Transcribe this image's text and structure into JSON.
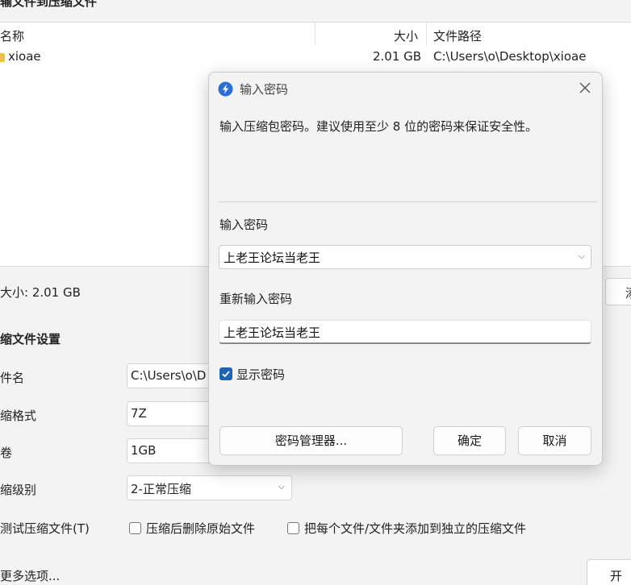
{
  "window": {
    "title_fragment": "输文件到压缩文件"
  },
  "file_list": {
    "columns": {
      "name": "名称",
      "size": "大小",
      "path": "文件路径"
    },
    "rows": [
      {
        "name": "xioae",
        "size": "2.01 GB",
        "path": "C:\\Users\\o\\Desktop\\xioae"
      }
    ]
  },
  "summary": {
    "size_text": "大小: 2.01 GB",
    "right_button_fragment": "添"
  },
  "settings": {
    "title": "缩文件设置",
    "fields": [
      {
        "label": "件名",
        "value": "C:\\Users\\o\\D"
      },
      {
        "label": "缩格式",
        "value": "7Z"
      },
      {
        "label": "卷",
        "value": "1GB"
      },
      {
        "label": "缩级别",
        "value": "2-正常压缩"
      }
    ],
    "test_label": "测试压缩文件(T)",
    "delete_after": "压缩后删除原始文件",
    "each_separate": "把每个文件/文件夹添加到独立的压缩文件",
    "more_options": "更多选项...",
    "start_button_fragment": "开"
  },
  "dialog": {
    "title": "输入密码",
    "description": "输入压缩包密码。建议使用至少 8 位的密码来保证安全性。",
    "password_label": "输入密码",
    "password_value": "上老王论坛当老王",
    "reenter_label": "重新输入密码",
    "reenter_value": "上老王论坛当老王",
    "show_password_label": "显示密码",
    "show_password_checked": true,
    "buttons": {
      "manager": "密码管理器...",
      "ok": "确定",
      "cancel": "取消"
    },
    "accent_color": "#1f63b6"
  }
}
